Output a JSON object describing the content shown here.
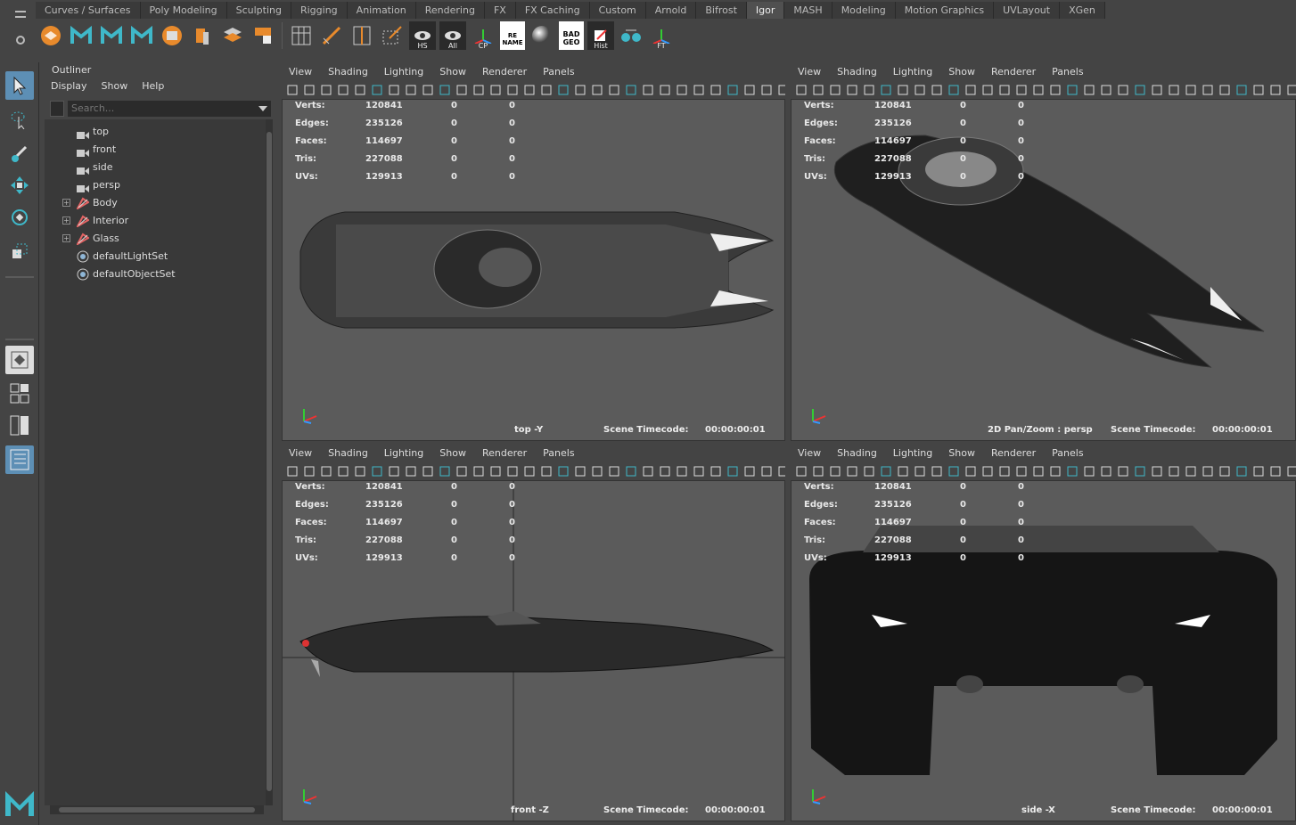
{
  "shelf": {
    "tabs": [
      "Curves / Surfaces",
      "Poly Modeling",
      "Sculpting",
      "Rigging",
      "Animation",
      "Rendering",
      "FX",
      "FX Caching",
      "Custom",
      "Arnold",
      "Bifrost",
      "Igor",
      "MASH",
      "Modeling",
      "Motion Graphics",
      "UVLayout",
      "XGen"
    ],
    "active_tab": "Igor",
    "icon_captions": {
      "hs": "HS",
      "all": "All",
      "cp": "CP",
      "rename": "RE NAME",
      "badgeo": "BAD GEO",
      "hist": "Hist",
      "ft": "FT"
    }
  },
  "outliner": {
    "title": "Outliner",
    "menu": [
      "Display",
      "Show",
      "Help"
    ],
    "search_placeholder": "Search...",
    "items": [
      {
        "label": "top",
        "icon": "camera-icon"
      },
      {
        "label": "front",
        "icon": "camera-icon"
      },
      {
        "label": "side",
        "icon": "camera-icon"
      },
      {
        "label": "persp",
        "icon": "camera-icon"
      },
      {
        "label": "Body",
        "icon": "group-icon"
      },
      {
        "label": "Interior",
        "icon": "group-icon"
      },
      {
        "label": "Glass",
        "icon": "group-icon"
      },
      {
        "label": "defaultLightSet",
        "icon": "set-icon"
      },
      {
        "label": "defaultObjectSet",
        "icon": "set-icon"
      }
    ]
  },
  "viewport_menu": [
    "View",
    "Shading",
    "Lighting",
    "Show",
    "Renderer",
    "Panels"
  ],
  "hud": {
    "labels": [
      "Verts:",
      "Edges:",
      "Faces:",
      "Tris:",
      "UVs:"
    ],
    "values": [
      "120841",
      "235126",
      "114697",
      "227088",
      "129913"
    ],
    "zero": "0"
  },
  "timecode_label": "Scene Timecode:",
  "timecode_value": "00:00:00:01",
  "viewports": {
    "top": {
      "camera": "top -Y"
    },
    "persp": {
      "camera": "2D Pan/Zoom : persp"
    },
    "front": {
      "camera": "front -Z"
    },
    "side": {
      "camera": "side -X"
    }
  },
  "colors": {
    "accent": "#5d8fb5",
    "maya_logo": "#3fb8c9"
  }
}
